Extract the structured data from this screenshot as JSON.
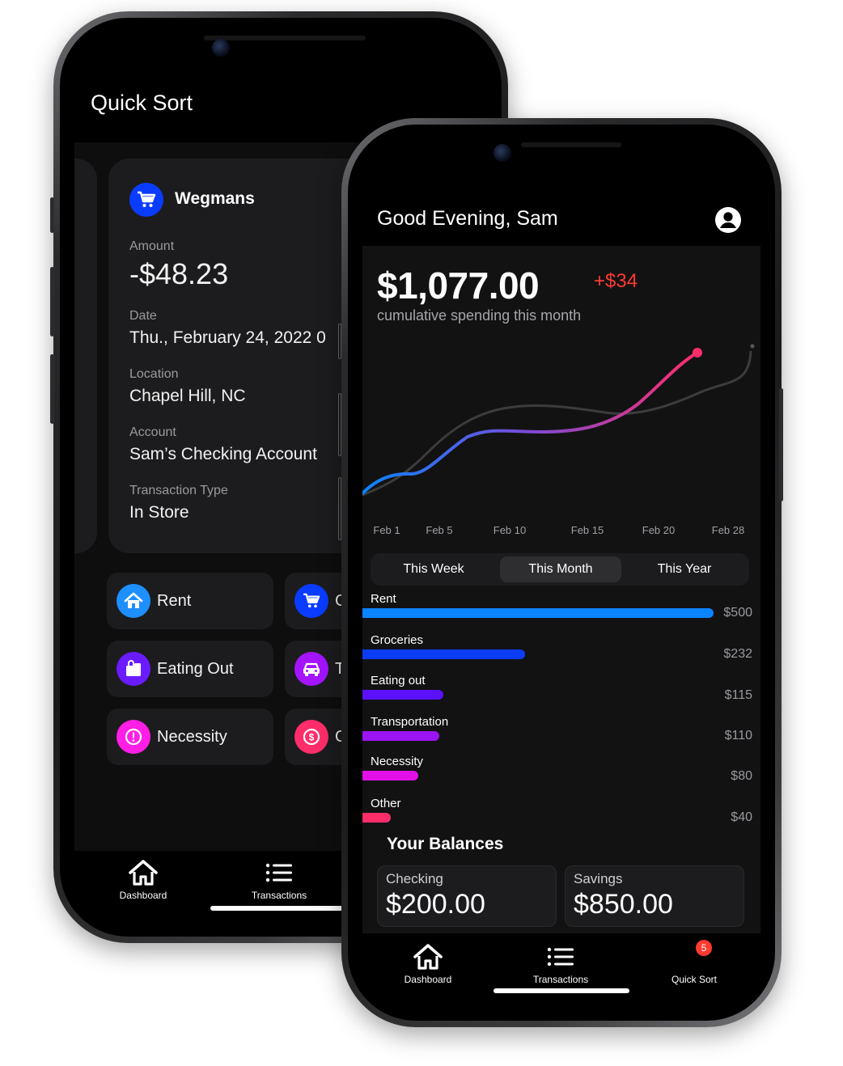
{
  "quick_sort_screen": {
    "title": "Quick Sort",
    "transaction": {
      "merchant": "Wegmans",
      "merchant_icon": "shopping-cart-icon",
      "amount_label": "Amount",
      "amount": "-$48.23",
      "date_label": "Date",
      "date": "Thu., February 24, 2022 0",
      "location_label": "Location",
      "location": "Chapel Hill, NC",
      "account_label": "Account",
      "account": "Sam’s Checking Account",
      "type_label": "Transaction Type",
      "type": "In Store"
    },
    "categories": [
      {
        "label": "Rent",
        "icon": "house-icon",
        "color": "#1e8fff"
      },
      {
        "label": "G",
        "icon": "shopping-cart-icon",
        "color": "#0a3cff"
      },
      {
        "label": "Eating Out",
        "icon": "food-bag-icon",
        "color": "#6a1bff"
      },
      {
        "label": "T",
        "icon": "car-icon",
        "color": "#a414ff"
      },
      {
        "label": "Necessity",
        "icon": "exclamation-icon",
        "color": "#ff1ee6"
      },
      {
        "label": "O",
        "icon": "dollar-icon",
        "color": "#ff2d6a"
      }
    ],
    "tabs": [
      {
        "label": "Dashboard",
        "icon": "house-icon"
      },
      {
        "label": "Transactions",
        "icon": "list-icon"
      }
    ]
  },
  "dashboard_screen": {
    "greeting": "Good Evening, Sam",
    "total_spending": "$1,077.00",
    "change": "+$34",
    "total_caption": "cumulative spending this month",
    "period_tabs": [
      "This Week",
      "This Month",
      "This Year"
    ],
    "selected_period": "This Month",
    "chart_data": {
      "type": "line",
      "x_ticks": [
        "Feb 1",
        "Feb 5",
        "Feb 10",
        "Feb 15",
        "Feb 20",
        "Feb 28"
      ]
    },
    "categories": [
      {
        "name": "Rent",
        "value": 500,
        "display": "$500",
        "color": "#0a84ff"
      },
      {
        "name": "Groceries",
        "value": 232,
        "display": "$232",
        "color": "#0b3df5"
      },
      {
        "name": "Eating out",
        "value": 115,
        "display": "$115",
        "color": "#5b10ff"
      },
      {
        "name": "Transportation",
        "value": 110,
        "display": "$110",
        "color": "#9b14f2"
      },
      {
        "name": "Necessity",
        "value": 80,
        "display": "$80",
        "color": "#e010e6"
      },
      {
        "name": "Other",
        "value": 40,
        "display": "$40",
        "color": "#ff2d6a"
      }
    ],
    "balances_title": "Your Balances",
    "balances": [
      {
        "label": "Checking",
        "amount": "$200.00"
      },
      {
        "label": "Savings",
        "amount": "$850.00"
      }
    ],
    "tabs": [
      {
        "label": "Dashboard",
        "icon": "house-icon"
      },
      {
        "label": "Transactions",
        "icon": "list-icon"
      },
      {
        "label": "Quick Sort",
        "icon": "sort-icon",
        "badge": "5"
      }
    ]
  }
}
